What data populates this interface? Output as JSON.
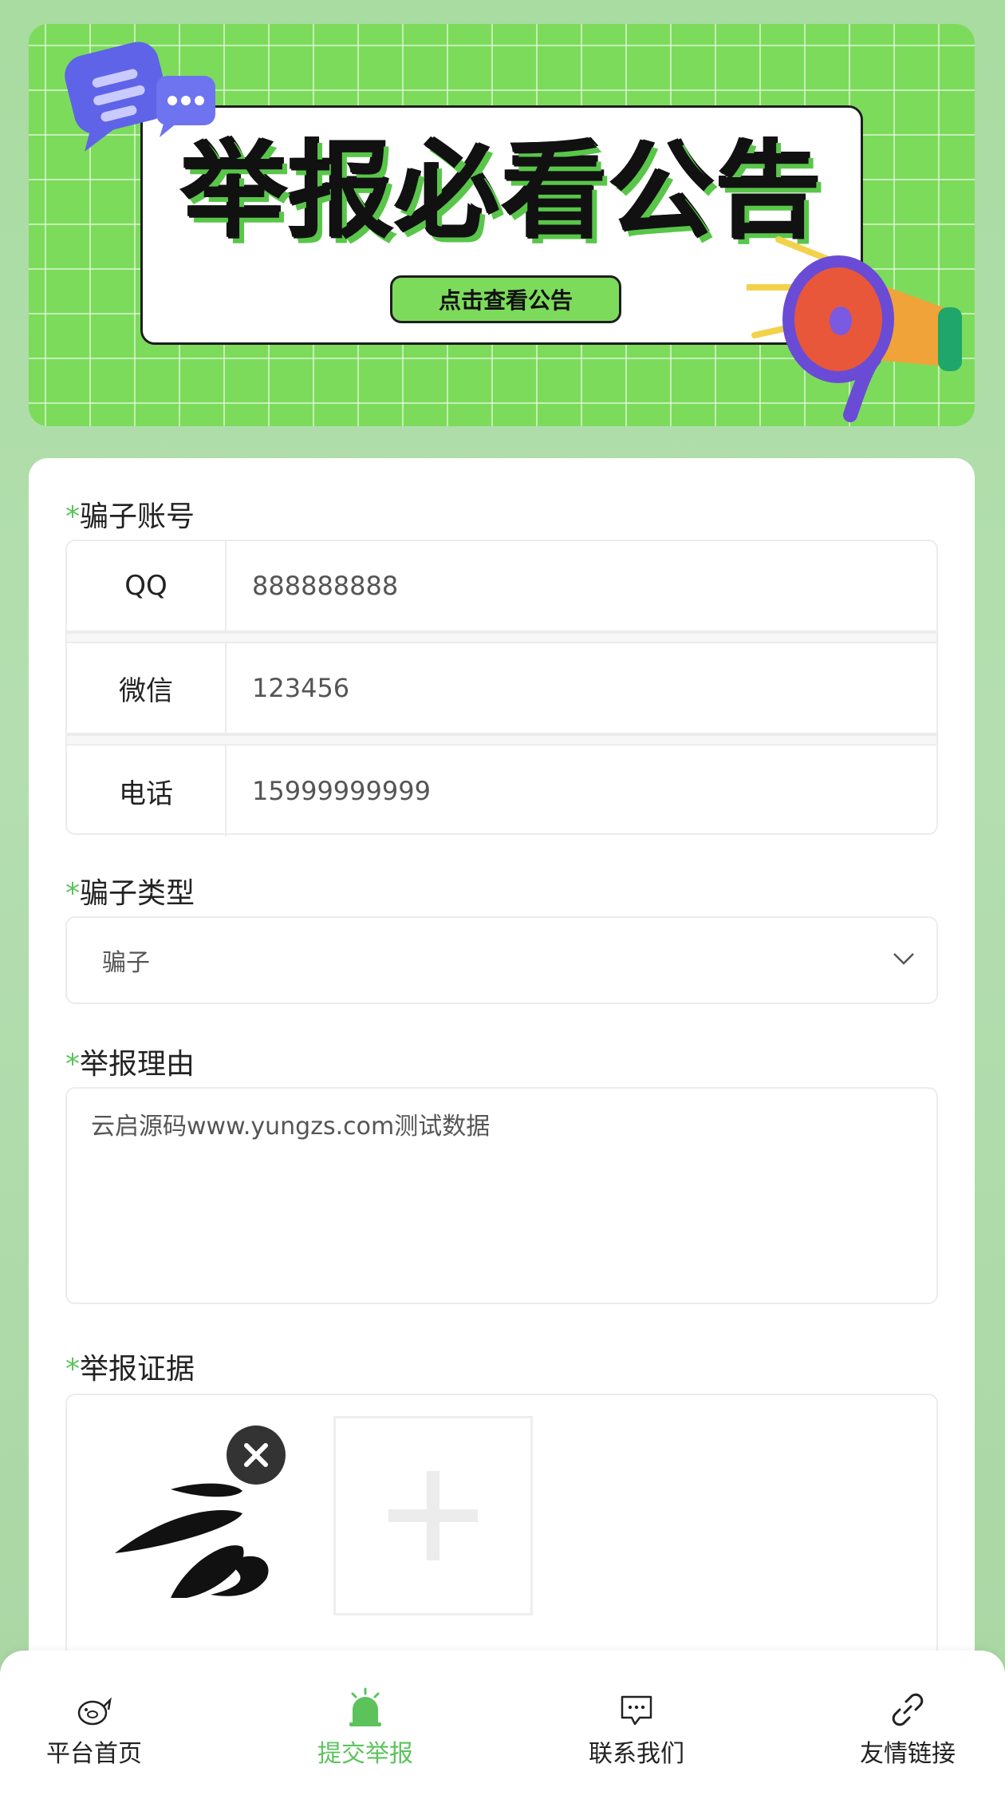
{
  "banner": {
    "title": "举报必看公告",
    "button_label": "点击查看公告"
  },
  "form": {
    "required_mark": "*",
    "account": {
      "label": "骗子账号",
      "rows": [
        {
          "key": "QQ",
          "value": "888888888"
        },
        {
          "key": "微信",
          "value": "123456"
        },
        {
          "key": "电话",
          "value": "15999999999"
        }
      ]
    },
    "type": {
      "label": "骗子类型",
      "selected": "骗子"
    },
    "reason": {
      "label": "举报理由",
      "value": "云启源码www.yungzs.com测试数据"
    },
    "evidence": {
      "label": "举报证据"
    }
  },
  "tabbar": {
    "items": [
      {
        "label": "平台首页",
        "icon": "home-icon"
      },
      {
        "label": "提交举报",
        "icon": "alarm-icon",
        "active": true
      },
      {
        "label": "联系我们",
        "icon": "message-icon"
      },
      {
        "label": "友情链接",
        "icon": "link-icon"
      }
    ]
  },
  "colors": {
    "accent": "#5cc35c",
    "banner_green": "#7ddb5c"
  }
}
